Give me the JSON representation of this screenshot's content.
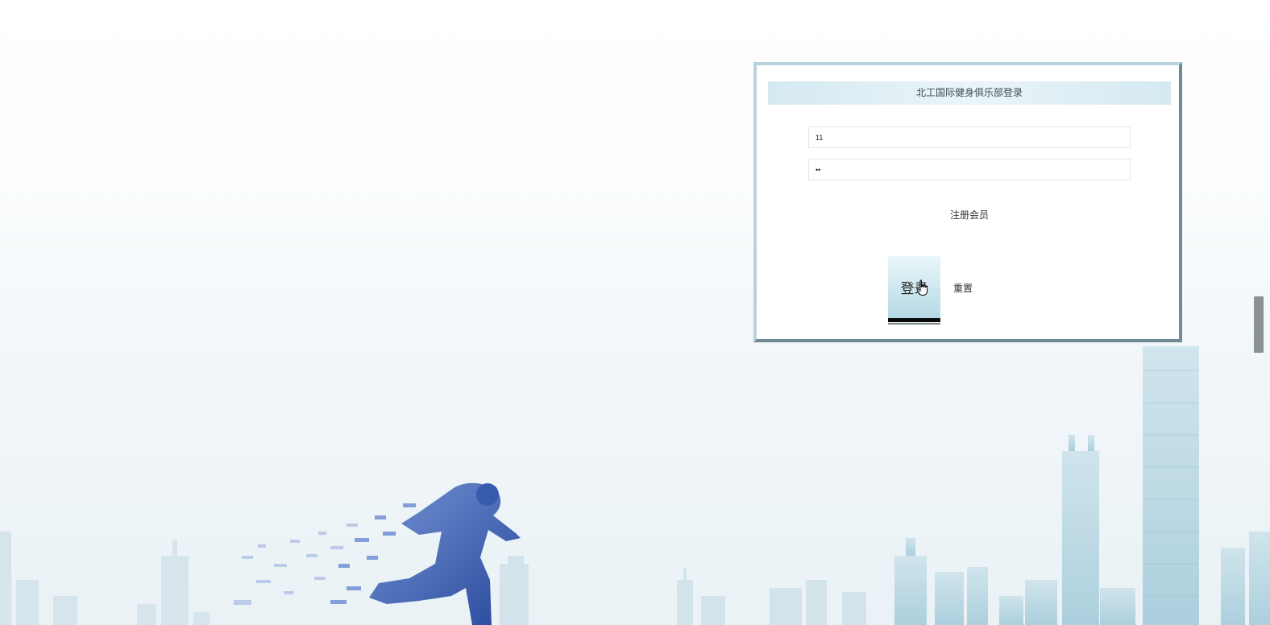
{
  "login": {
    "title": "北工国际健身俱乐部登录",
    "username_value": "11",
    "password_value": "••",
    "register_label": "注册会员",
    "login_label": "登录",
    "reset_label": "重置"
  },
  "background": {
    "scene": "city-skyline",
    "figure": "running-man-pixel-art",
    "colors": {
      "sky_top": "#ffffff",
      "sky_bottom": "#eaf2f6",
      "building": "#b8d6e1",
      "runner": "#2a4fa8"
    }
  },
  "icons": {
    "cursor": "hand-pointer-icon"
  }
}
